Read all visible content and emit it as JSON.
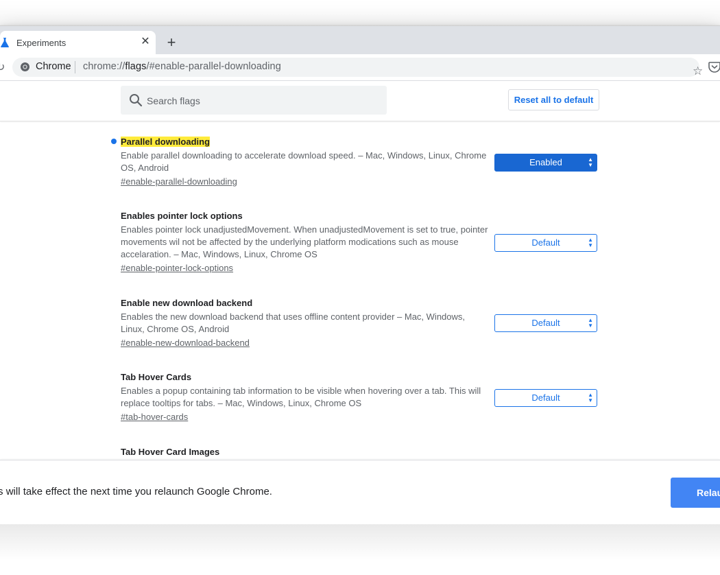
{
  "tab": {
    "title": "Experiments",
    "close": "✕",
    "new_tab": "+"
  },
  "omnibox": {
    "site_label": "Chrome",
    "url_prefix": "chrome://",
    "url_host": "flags",
    "url_rest": "/#enable-parallel-downloading"
  },
  "search": {
    "placeholder": "Search flags"
  },
  "reset_button": "Reset all to default",
  "flags": [
    {
      "title": "Parallel downloading",
      "description": "Enable parallel downloading to accelerate download speed. – Mac, Windows, Linux, Chrome OS, Android",
      "link": "#enable-parallel-downloading",
      "value": "Enabled",
      "modified": true
    },
    {
      "title": "Enables pointer lock options",
      "description": "Enables pointer lock unadjustedMovement. When unadjustedMovement is set to true, pointer movements wil not be affected by the underlying platform modications such as mouse accelaration. – Mac, Windows, Linux, Chrome OS",
      "link": "#enable-pointer-lock-options",
      "value": "Default"
    },
    {
      "title": "Enable new download backend",
      "description": "Enables the new download backend that uses offline content provider – Mac, Windows, Linux, Chrome OS, Android",
      "link": "#enable-new-download-backend",
      "value": "Default"
    },
    {
      "title": "Tab Hover Cards",
      "description": "Enables a popup containing tab information to be visible when hovering over a tab. This will replace tooltips for tabs. – Mac, Windows, Linux, Chrome OS",
      "link": "#tab-hover-cards",
      "value": "Default"
    },
    {
      "title": "Tab Hover Card Images"
    }
  ],
  "relaunch": {
    "message": "nges will take effect the next time you relaunch Google Chrome.",
    "button": "Relau"
  },
  "colors": {
    "accent": "#1a73e8",
    "highlight": "#ffeb3b",
    "relaunch_button": "#4285f4"
  }
}
